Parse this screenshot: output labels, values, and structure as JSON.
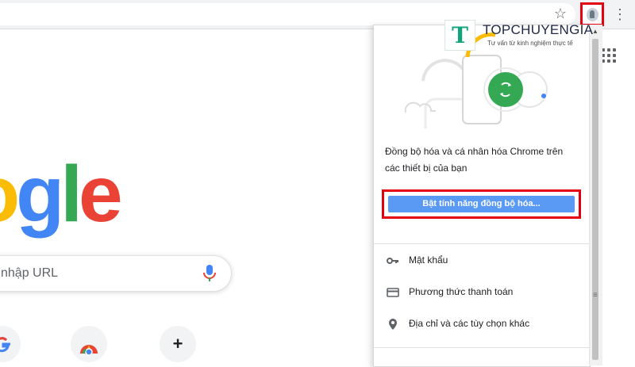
{
  "toolbar": {
    "star_icon": "star-outline-icon",
    "profile_icon": "profile-avatar-icon",
    "menu_icon": "vertical-dots-icon"
  },
  "ntp": {
    "logo_letters": [
      "o",
      "g",
      "l",
      "e"
    ],
    "logo_colors": [
      "#fbbc05",
      "#4285f4",
      "#34a853",
      "#ea4335"
    ],
    "search_placeholder": "nhập URL",
    "shortcuts": [
      {
        "icon": "google-g-icon"
      },
      {
        "icon": "chrome-icon"
      },
      {
        "icon": "plus-icon",
        "glyph": "+"
      }
    ]
  },
  "panel": {
    "sync_text": "Đồng bộ hóa và cá nhân hóa Chrome trên các thiết bị của bạn",
    "sync_button": "Bật tính năng đồng bộ hóa...",
    "items": [
      {
        "label": "Mật khẩu",
        "icon": "key-icon"
      },
      {
        "label": "Phương thức thanh toán",
        "icon": "credit-card-icon"
      },
      {
        "label": "Địa chỉ và các tùy chọn khác",
        "icon": "location-pin-icon"
      }
    ]
  },
  "watermark": {
    "letter": "T",
    "name": "TOPCHUYENGIA",
    "tagline": "Tư vấn từ kinh nghiệm thực tế"
  },
  "colors": {
    "highlight": "#e3000f",
    "sync_button": "#5a9af5",
    "sync_green": "#34a853"
  }
}
